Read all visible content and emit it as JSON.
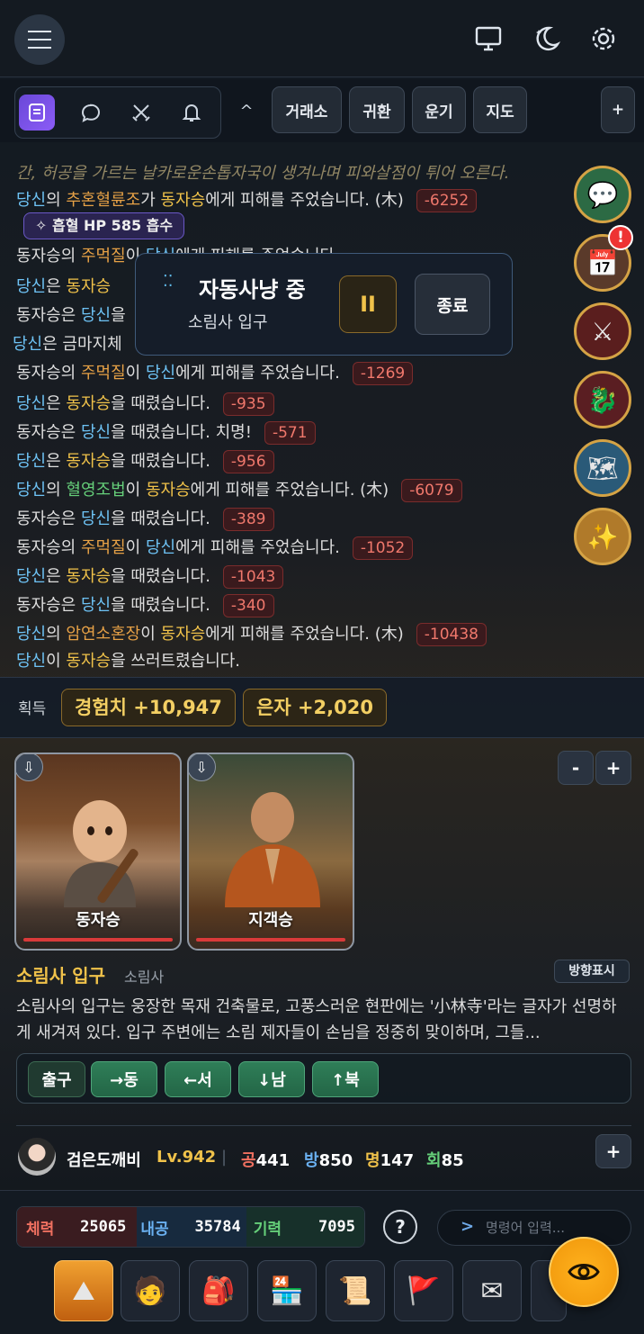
{
  "tabs": {
    "trade": "거래소",
    "return": "귀환",
    "luck": "운기",
    "map": "지도",
    "add": "+",
    "collapse": "^"
  },
  "log": {
    "top_fade": "간, 허공을 가르는 날카로운손톱자국이 생겨나며 피와살점이 튀어 오른다.",
    "absorb": "흡혈  HP 585 흡수",
    "lines": [
      [
        {
          "t": "당신",
          "c": "b"
        },
        {
          "t": "의 ",
          "c": ""
        },
        {
          "t": "추혼혈륜조",
          "c": "o"
        },
        {
          "t": "가 ",
          "c": ""
        },
        {
          "t": "동자승",
          "c": "y"
        },
        {
          "t": "에게 피해를 주었습니다. (木)",
          "c": ""
        },
        {
          "d": "-6252"
        }
      ],
      [
        {
          "t": "동자승의 ",
          "c": ""
        },
        {
          "t": "주먹질",
          "c": "o"
        },
        {
          "t": "이 ",
          "c": ""
        },
        {
          "t": "당신",
          "c": "b"
        },
        {
          "t": "에게 피해를 주었습니다.",
          "c": ""
        }
      ],
      [
        {
          "t": "당신",
          "c": "b"
        },
        {
          "t": "은 ",
          "c": ""
        },
        {
          "t": "동자승",
          "c": "y"
        }
      ],
      [
        {
          "t": "동자승은 ",
          "c": ""
        },
        {
          "t": "당신",
          "c": "b"
        },
        {
          "t": "을",
          "c": ""
        }
      ],
      [
        {
          "t": "당신",
          "c": "b"
        },
        {
          "t": "은 금마지체",
          "c": ""
        }
      ],
      [
        {
          "t": "동자승의 ",
          "c": ""
        },
        {
          "t": "주먹질",
          "c": "o"
        },
        {
          "t": "이 ",
          "c": ""
        },
        {
          "t": "당신",
          "c": "b"
        },
        {
          "t": "에게 피해를 주었습니다.",
          "c": ""
        },
        {
          "d": "-1269"
        }
      ],
      [
        {
          "t": "당신",
          "c": "b"
        },
        {
          "t": "은 ",
          "c": ""
        },
        {
          "t": "동자승",
          "c": "y"
        },
        {
          "t": "을 때렸습니다.",
          "c": ""
        },
        {
          "d": "-935"
        }
      ],
      [
        {
          "t": "동자승은 ",
          "c": ""
        },
        {
          "t": "당신",
          "c": "b"
        },
        {
          "t": "을 때렸습니다. 치명!",
          "c": ""
        },
        {
          "d": "-571"
        }
      ],
      [
        {
          "t": "당신",
          "c": "b"
        },
        {
          "t": "은 ",
          "c": ""
        },
        {
          "t": "동자승",
          "c": "y"
        },
        {
          "t": "을 때렸습니다.",
          "c": ""
        },
        {
          "d": "-956"
        }
      ],
      [
        {
          "t": "당신",
          "c": "b"
        },
        {
          "t": "의 ",
          "c": ""
        },
        {
          "t": "혈영조법",
          "c": "g"
        },
        {
          "t": "이 ",
          "c": ""
        },
        {
          "t": "동자승",
          "c": "y"
        },
        {
          "t": "에게 피해를 주었습니다. (木)",
          "c": ""
        },
        {
          "d": "-6079"
        }
      ],
      [
        {
          "t": "동자승은 ",
          "c": ""
        },
        {
          "t": "당신",
          "c": "b"
        },
        {
          "t": "을 때렸습니다.",
          "c": ""
        },
        {
          "d": "-389"
        }
      ],
      [
        {
          "t": "동자승의 ",
          "c": ""
        },
        {
          "t": "주먹질",
          "c": "o"
        },
        {
          "t": "이 ",
          "c": ""
        },
        {
          "t": "당신",
          "c": "b"
        },
        {
          "t": "에게 피해를 주었습니다.",
          "c": ""
        },
        {
          "d": "-1052"
        }
      ],
      [
        {
          "t": "당신",
          "c": "b"
        },
        {
          "t": "은 ",
          "c": ""
        },
        {
          "t": "동자승",
          "c": "y"
        },
        {
          "t": "을 때렸습니다.",
          "c": ""
        },
        {
          "d": "-1043"
        }
      ],
      [
        {
          "t": "동자승은 ",
          "c": ""
        },
        {
          "t": "당신",
          "c": "b"
        },
        {
          "t": "을 때렸습니다.",
          "c": ""
        },
        {
          "d": "-340"
        }
      ],
      [
        {
          "t": "당신",
          "c": "b"
        },
        {
          "t": "의 ",
          "c": ""
        },
        {
          "t": "암연소혼장",
          "c": "o"
        },
        {
          "t": "이 ",
          "c": ""
        },
        {
          "t": "동자승",
          "c": "y"
        },
        {
          "t": "에게 피해를 주었습니다. (木)",
          "c": ""
        },
        {
          "d": "-10438"
        }
      ],
      [
        {
          "t": "당신",
          "c": "b"
        },
        {
          "t": "이 ",
          "c": ""
        },
        {
          "t": "동자승",
          "c": "y"
        },
        {
          "t": "을 쓰러트렸습니다.",
          "c": ""
        }
      ]
    ]
  },
  "auto_hunt": {
    "title": "자동사냥 중",
    "location": "소림사 입구",
    "pause": "II",
    "stop": "종료"
  },
  "gain": {
    "label": "획득",
    "exp": "경험치 +10,947",
    "silver": "은자 +2,020"
  },
  "monsters": [
    {
      "name": "동자승"
    },
    {
      "name": "지객승"
    }
  ],
  "zoom": {
    "minus": "-",
    "plus": "+"
  },
  "location": {
    "name": "소림사 입구",
    "region": "소림사",
    "direction_btn": "방향표시",
    "desc": "소림사의 입구는 웅장한 목재 건축물로, 고풍스러운 현판에는 '小林寺'라는 글자가 선명하게 새겨져 있다. 입구 주변에는 소림 제자들이 손님을 정중히 맞이하며, 그들...",
    "exits": [
      "출구",
      "→동",
      "←서",
      "↓남",
      "↑북"
    ]
  },
  "character": {
    "name": "검은도깨비",
    "level": "Lv.942",
    "stats": [
      {
        "k": "공",
        "v": "441",
        "c": "#f07060"
      },
      {
        "k": "방",
        "v": "850",
        "c": "#6ab0f0"
      },
      {
        "k": "명",
        "v": "147",
        "c": "#f0c24a"
      },
      {
        "k": "회",
        "v": "85",
        "c": "#66d07a"
      }
    ],
    "add": "+"
  },
  "vitals": [
    {
      "label": "체력",
      "value": "25065",
      "color": "#f07060",
      "bg": "#3a1c20"
    },
    {
      "label": "내공",
      "value": "35784",
      "color": "#6ab0f0",
      "bg": "#172a3e"
    },
    {
      "label": "기력",
      "value": "7095",
      "color": "#66d07a",
      "bg": "#17302a"
    }
  ],
  "help": "?",
  "command": {
    "arrow": ">",
    "placeholder": "명령어 입력..."
  }
}
